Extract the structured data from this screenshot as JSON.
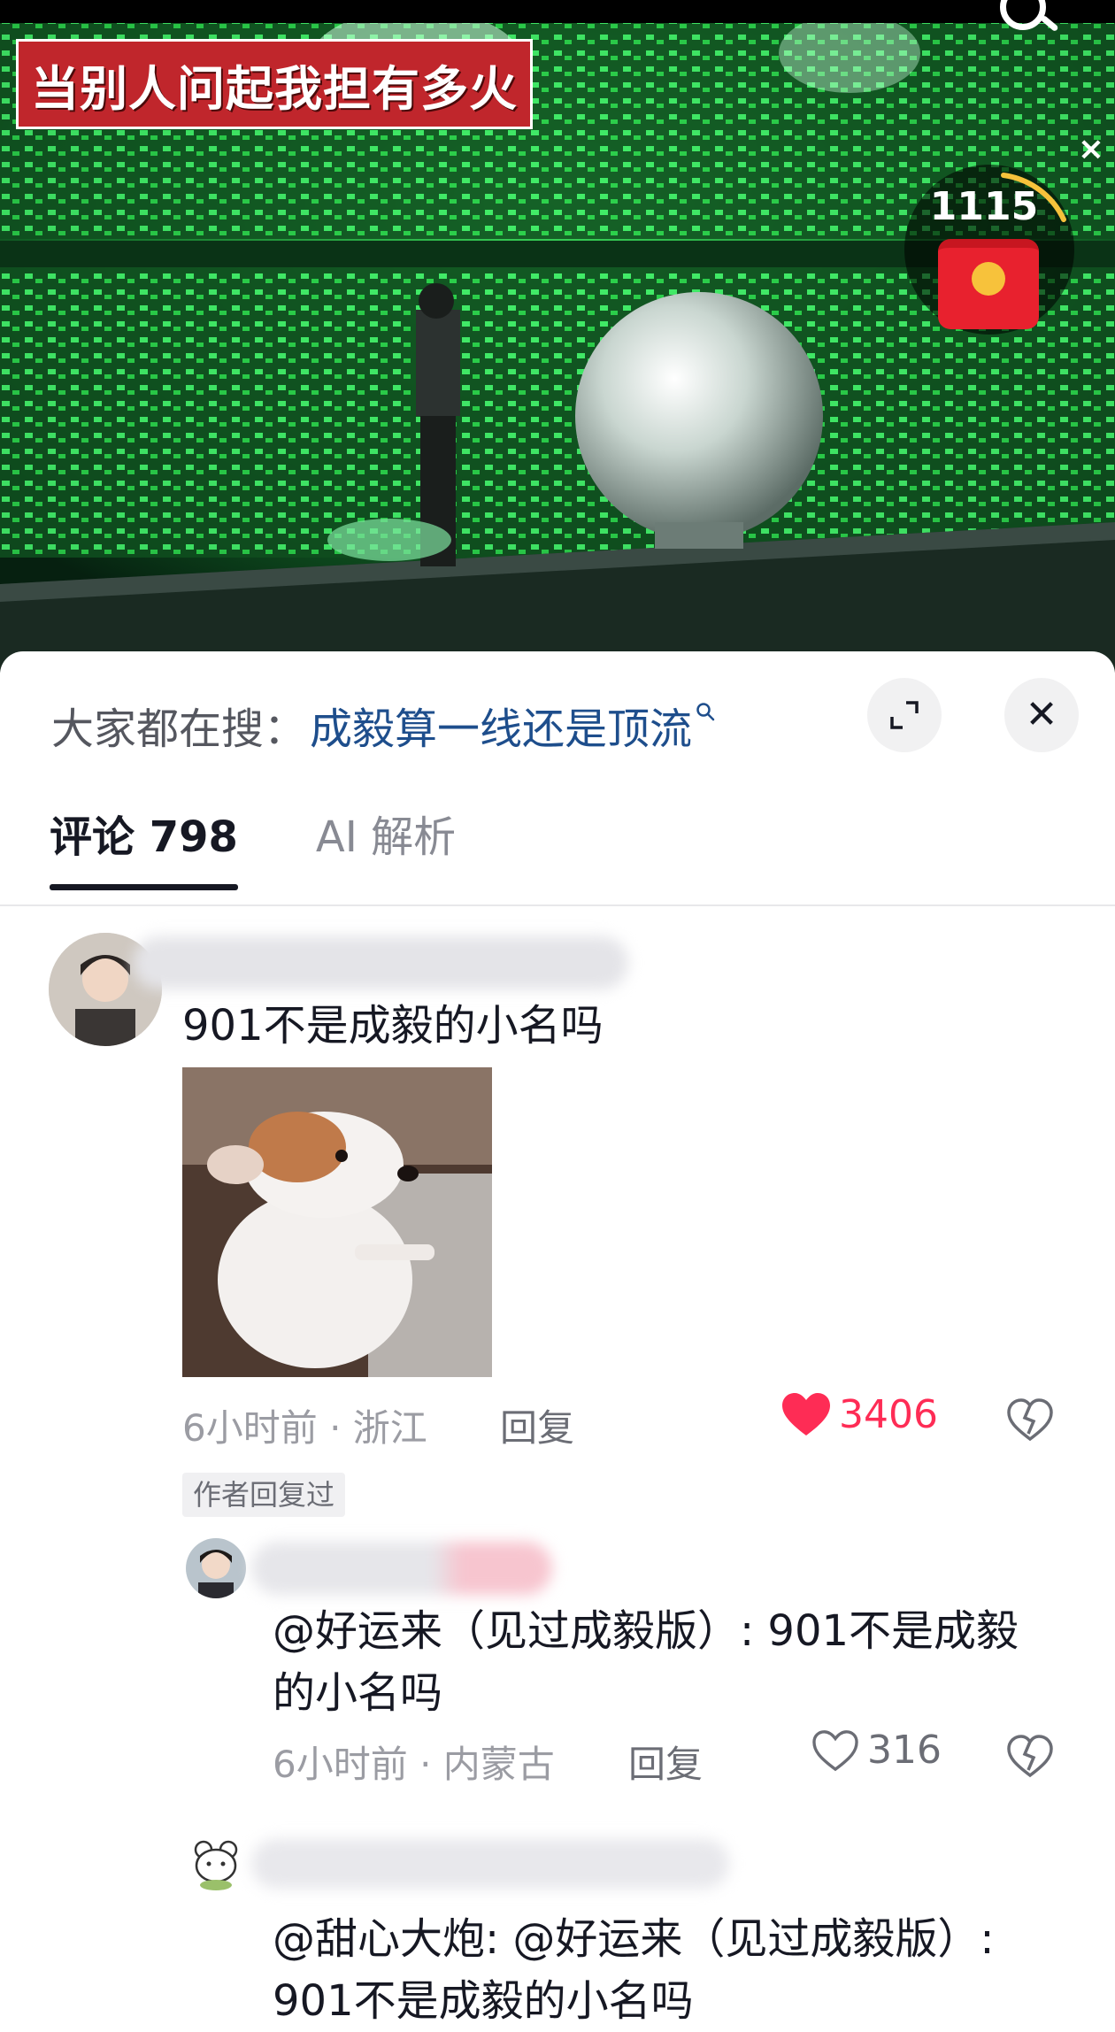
{
  "video": {
    "caption": "当别人问起我担有多火",
    "close_symbol": "×",
    "redpacket_count": "1115"
  },
  "panel": {
    "hot_search_prefix": "大家都在搜：",
    "hot_search_query": "成毅算一线还是顶流",
    "close_symbol": "✕",
    "tabs": [
      {
        "label": "评论 798",
        "active": true
      },
      {
        "label": "AI 解析",
        "active": false
      }
    ]
  },
  "comments": [
    {
      "text": "901不是成毅的小名吗",
      "time_location": "6小时前 · 浙江",
      "reply_label": "回复",
      "likes": "3406",
      "liked": true,
      "author_tag": "作者回复过"
    }
  ],
  "replies": [
    {
      "text_line1": "@好运来（见过成毅版）: 901不是成毅",
      "text_line2": "的小名吗",
      "time_location": "6小时前 · 内蒙古",
      "reply_label": "回复",
      "likes": "316"
    },
    {
      "text_line1": "@甜心大炮: @好运来（见过成毅版）:",
      "text_line2": "901不是成毅的小名吗"
    }
  ],
  "colors": {
    "accent_like": "#fe2c55",
    "hot_query": "#1e4e8c",
    "stage_green": "#2bd14a"
  }
}
